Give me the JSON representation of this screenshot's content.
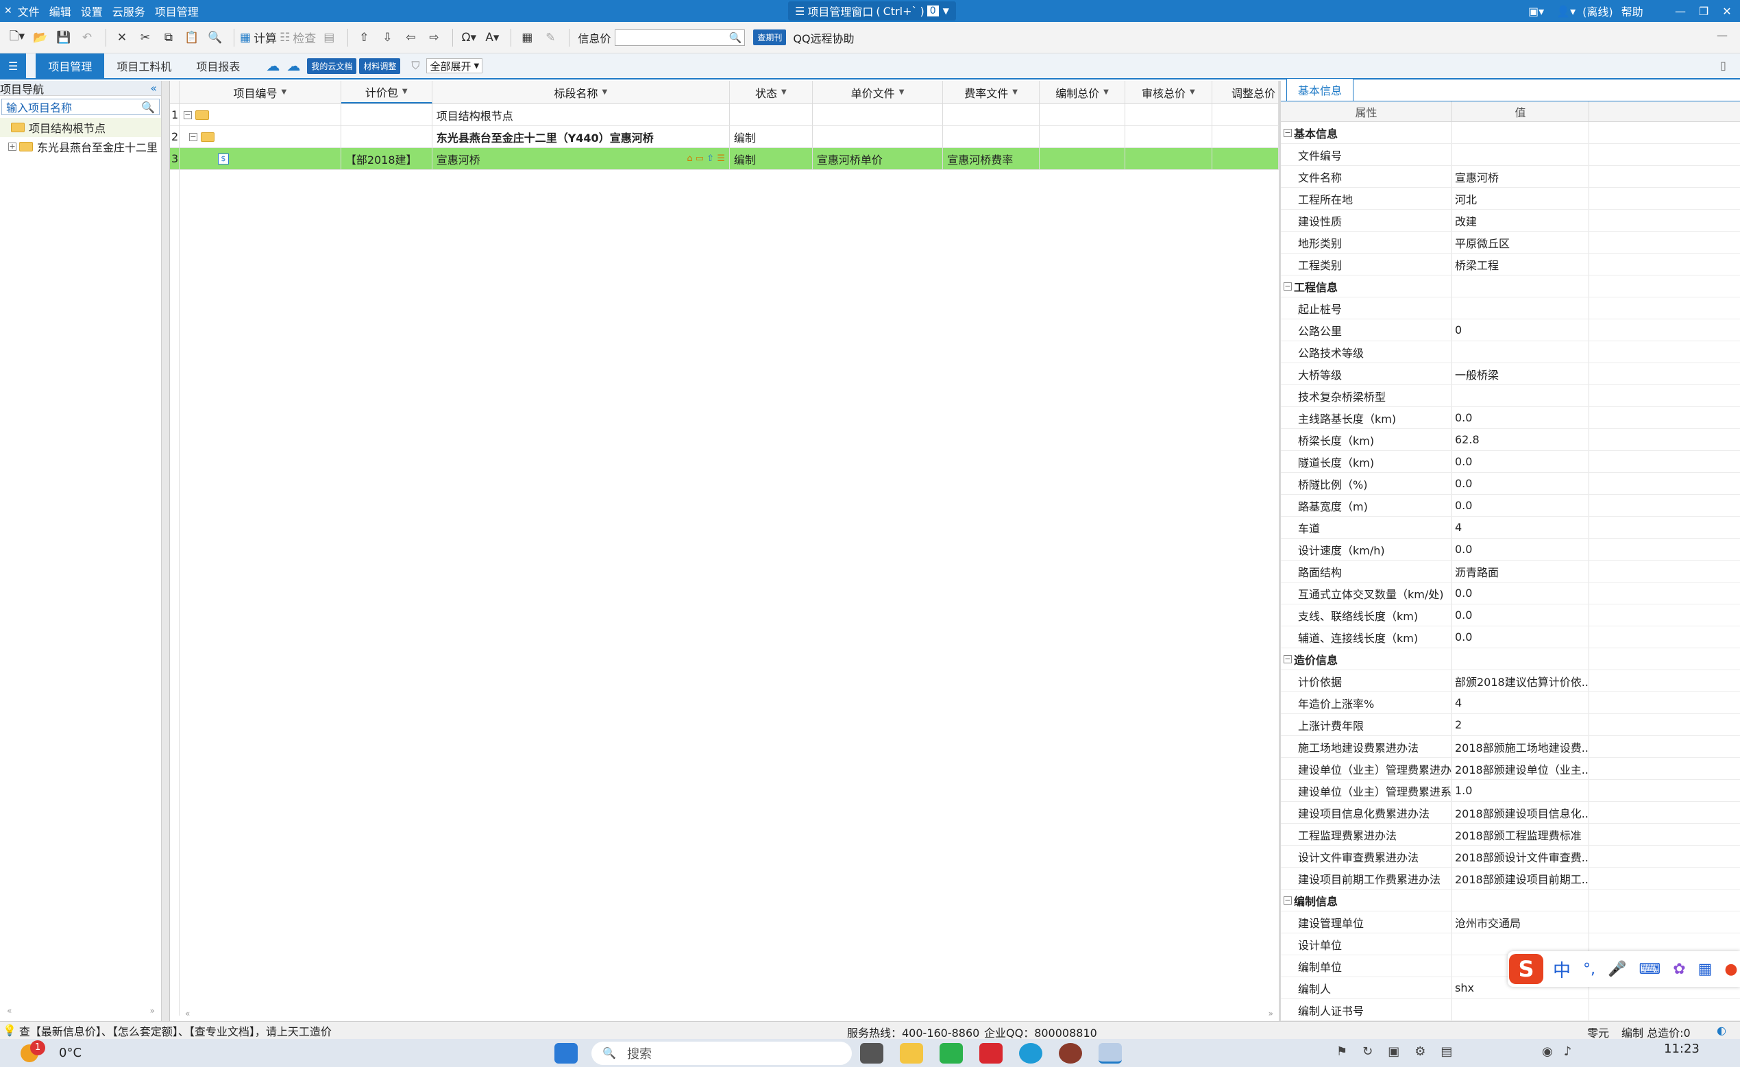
{
  "titlebar": {
    "menu": [
      "文件",
      "编辑",
      "设置",
      "云服务",
      "项目管理"
    ],
    "window_title": "项目管理窗口",
    "shortcut": "Ctrl+`",
    "count": "0",
    "mode": "(离线)",
    "help": "帮助"
  },
  "toolbar": {
    "calc": "计算",
    "check": "检查",
    "info_price_label": "信息价",
    "info_price_value": "",
    "period_badge": "查期刊",
    "qq_remote": "QQ远程协助"
  },
  "tabs": [
    "项目管理",
    "项目工料机",
    "项目报表"
  ],
  "tabbar": {
    "cloud_docs": "我的云文档",
    "material_adjust": "材料调整",
    "expand_all": "全部展开"
  },
  "nav": {
    "title": "项目导航",
    "search_placeholder": "输入项目名称",
    "items": [
      "项目结构根节点",
      "东光县燕台至金庄十二里"
    ]
  },
  "grid": {
    "columns": [
      "项目编号",
      "计价包",
      "标段名称",
      "状态",
      "单价文件",
      "费率文件",
      "编制总价",
      "审核总价",
      "调整总价"
    ],
    "rows": [
      {
        "num": "1",
        "code": "",
        "pkg": "",
        "name": "项目结构根节点",
        "status": "",
        "unit_file": "",
        "rate_file": ""
      },
      {
        "num": "2",
        "code": "",
        "pkg": "",
        "name": "东光县燕台至金庄十二里（Y440）宣惠河桥",
        "status": "编制",
        "unit_file": "",
        "rate_file": ""
      },
      {
        "num": "3",
        "code": "",
        "pkg": "【部2018建】",
        "name": "宣惠河桥",
        "status": "编制",
        "unit_file": "宣惠河桥单价",
        "rate_file": "宣惠河桥费率"
      }
    ]
  },
  "props": {
    "tab": "基本信息",
    "col_attr": "属性",
    "col_value": "值",
    "sections": [
      {
        "title": "基本信息",
        "rows": [
          [
            "文件编号",
            ""
          ],
          [
            "文件名称",
            "宣惠河桥"
          ],
          [
            "工程所在地",
            "河北"
          ],
          [
            "建设性质",
            "改建"
          ],
          [
            "地形类别",
            "平原微丘区"
          ],
          [
            "工程类别",
            "桥梁工程"
          ]
        ]
      },
      {
        "title": "工程信息",
        "rows": [
          [
            "起止桩号",
            ""
          ],
          [
            "公路公里",
            "0"
          ],
          [
            "公路技术等级",
            ""
          ],
          [
            "大桥等级",
            "一般桥梁"
          ],
          [
            "技术复杂桥梁桥型",
            ""
          ],
          [
            "主线路基长度（km)",
            "0.0"
          ],
          [
            "桥梁长度（km)",
            "62.8"
          ],
          [
            "隧道长度（km)",
            "0.0"
          ],
          [
            "桥隧比例（%)",
            "0.0"
          ],
          [
            "路基宽度（m)",
            "0.0"
          ],
          [
            "车道",
            "4"
          ],
          [
            "设计速度（km/h)",
            "0.0"
          ],
          [
            "路面结构",
            "沥青路面"
          ],
          [
            "互通式立体交叉数量（km/处)",
            "0.0"
          ],
          [
            "支线、联络线长度（km)",
            "0.0"
          ],
          [
            "辅道、连接线长度（km)",
            "0.0"
          ]
        ]
      },
      {
        "title": "造价信息",
        "rows": [
          [
            "计价依据",
            "部颁2018建议估算计价依..."
          ],
          [
            "年造价上涨率%",
            "4"
          ],
          [
            "上涨计费年限",
            "2"
          ],
          [
            "施工场地建设费累进办法",
            "2018部颁施工场地建设费..."
          ],
          [
            "建设单位（业主）管理费累进办法",
            "2018部颁建设单位（业主..."
          ],
          [
            "建设单位（业主）管理费累进系数",
            "1.0"
          ],
          [
            "建设项目信息化费累进办法",
            "2018部颁建设项目信息化..."
          ],
          [
            "工程监理费累进办法",
            "2018部颁工程监理费标准"
          ],
          [
            "设计文件审查费累进办法",
            "2018部颁设计文件审查费..."
          ],
          [
            "建设项目前期工作费累进办法",
            "2018部颁建设项目前期工..."
          ]
        ]
      },
      {
        "title": "编制信息",
        "rows": [
          [
            "建设管理单位",
            "沧州市交通局"
          ],
          [
            "设计单位",
            ""
          ],
          [
            "编制单位",
            ""
          ],
          [
            "编制人",
            "shx"
          ],
          [
            "编制人证书号",
            ""
          ]
        ]
      }
    ]
  },
  "status": {
    "tip": "查【最新信息价】、【怎么套定额】、【查专业文档】，请上天工造价",
    "hotline": "服务热线：400-160-8860",
    "qq": "企业QQ：800008810",
    "unit": "零元",
    "total": "编制 总造价:0"
  },
  "taskbar": {
    "weather": "0°C",
    "badge": "1",
    "search": "搜索",
    "time": "11:23"
  },
  "ime": {
    "lang": "中"
  },
  "colors": {
    "accent": "#1e7ac7",
    "selected_row": "#8fe06f"
  }
}
